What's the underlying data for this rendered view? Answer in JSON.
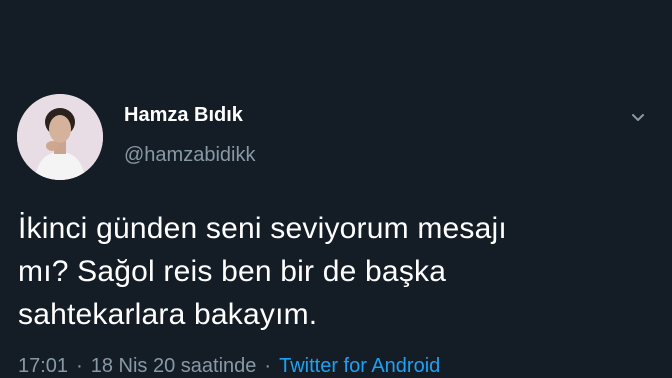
{
  "tweet": {
    "author_name": "Hamza Bıdık",
    "author_handle": "@hamzabidikk",
    "text": "İkinci günden seni seviyorum mesajı\nmı? Sağol reis ben bir de başka\nsahtekarlara bakayım.",
    "time": "17:01",
    "date": "18 Nis 20 saatinde",
    "separator": "·",
    "source": "Twitter for Android"
  },
  "icons": {
    "avatar": "profile-photo",
    "menu": "chevron-down-icon"
  },
  "colors": {
    "background": "#141d26",
    "text": "#ffffff",
    "secondary_text": "#8899a6",
    "link": "#1da1f2"
  }
}
